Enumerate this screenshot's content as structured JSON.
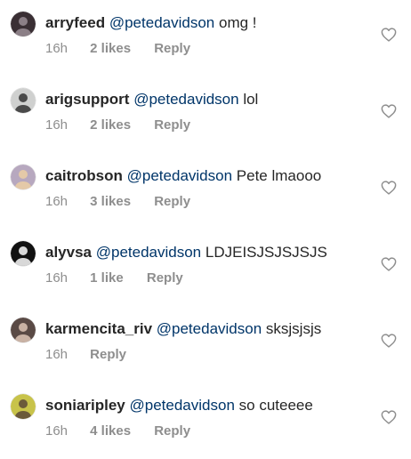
{
  "comments": [
    {
      "username": "arryfeed",
      "mention": "@petedavidson",
      "text": "omg !",
      "time": "16h",
      "likes": "2 likes",
      "reply": "Reply",
      "avatar_color": "#3a2f34",
      "avatar_accent": "#8b7f86"
    },
    {
      "username": "arigsupport",
      "mention": "@petedavidson",
      "text": "lol",
      "time": "16h",
      "likes": "2 likes",
      "reply": "Reply",
      "avatar_color": "#cfd0cf",
      "avatar_accent": "#4a4a4a"
    },
    {
      "username": "caitrobson",
      "mention": "@petedavidson",
      "text": "Pete lmaooo",
      "time": "16h",
      "likes": "3 likes",
      "reply": "Reply",
      "avatar_color": "#b7a8bf",
      "avatar_accent": "#e4c9a8"
    },
    {
      "username": "alyvsa",
      "mention": "@petedavidson",
      "text": "LDJEISJSJSJSJS",
      "time": "16h",
      "likes": "1 like",
      "reply": "Reply",
      "avatar_color": "#111111",
      "avatar_accent": "#d8d8d8"
    },
    {
      "username": "karmencita_riv",
      "mention": "@petedavidson",
      "text": "sksjsjsjs",
      "time": "16h",
      "likes": "",
      "reply": "Reply",
      "avatar_color": "#5a4a45",
      "avatar_accent": "#c9b2a4"
    },
    {
      "username": "soniaripley",
      "mention": "@petedavidson",
      "text": "so cuteeee",
      "time": "16h",
      "likes": "4 likes",
      "reply": "Reply",
      "avatar_color": "#c8c34a",
      "avatar_accent": "#6b5a3a"
    }
  ],
  "colors": {
    "username": "#262626",
    "mention": "#003569",
    "meta": "#8e8e8e",
    "heart_stroke": "#8e8e8e"
  },
  "icons": {
    "heart": "heart-outline-icon",
    "avatar": "profile-avatar"
  }
}
